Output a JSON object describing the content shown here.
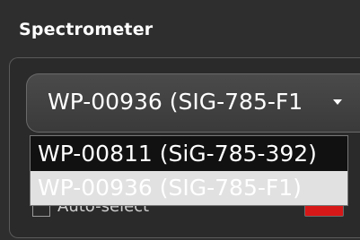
{
  "section": {
    "title": "Spectrometer"
  },
  "select": {
    "selected_value": "WP-00936 (SIG-785-F1",
    "arrow_icon": "dropdown-arrow-icon"
  },
  "dropdown": {
    "options": [
      {
        "label": "WP-00811 (SiG-785-392)",
        "highlighted": false
      },
      {
        "label": "WP-00936 (SIG-785-F1)",
        "highlighted": true
      }
    ]
  },
  "checkbox": {
    "label": "Auto-select",
    "checked": false
  },
  "colors": {
    "background": "#2e2e2e",
    "highlight": "#e1e1e1",
    "indicator": "#d61818"
  }
}
